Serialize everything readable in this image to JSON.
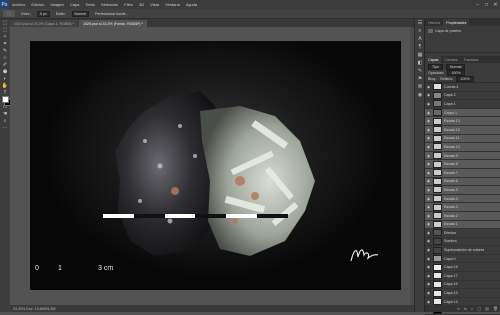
{
  "app": {
    "logo": "Ps"
  },
  "menu": [
    "Archivo",
    "Edición",
    "Imagen",
    "Capa",
    "Texto",
    "Selección",
    "Filtro",
    "3D",
    "Vista",
    "Ventana",
    "Ayuda"
  ],
  "window_controls": [
    "–",
    "□",
    "✕"
  ],
  "options_bar": {
    "feather_label": "Desv.:",
    "feather_value": "0 px",
    "style_label": "Estilo:",
    "style_value": "Normal",
    "refine_label": "Perfeccionar borde..."
  },
  "document_tabs": [
    {
      "label": "1024.psd al 33,3% (Capa 1, RGB/8) *",
      "active": false
    },
    {
      "label": "1025.psd al 33,3% (Fondo, RGB/8*) *",
      "active": true
    }
  ],
  "toolbox": [
    "⬚",
    "⬚",
    "✧",
    "⌗",
    "✎",
    "⊹",
    "✐",
    "⬣",
    "◐",
    "✋",
    "T",
    "↖",
    "▭",
    "☚",
    "⌕",
    "⋯"
  ],
  "canvas": {
    "scale_labels": [
      "0",
      "1",
      "3 cm"
    ],
    "background": "#0b0b0b",
    "scale_colors": [
      "#ffffff",
      "#111111"
    ]
  },
  "status": "33,33%   Doc: 19,5M/91,5M",
  "side_icons": [
    "☰",
    "≡",
    "A",
    "¶",
    "▦",
    "◧",
    "✎",
    "⚑",
    "⌘",
    "◉"
  ],
  "right_panel": {
    "tabs": [
      "Historia",
      "Propiedades"
    ],
    "props_title": "Capa de píxeles",
    "layers_tabs": [
      "Capas",
      "Canales",
      "Trazados"
    ],
    "filter_label": "Tipo",
    "blend": "Normal",
    "opacity_label": "Opacidad:",
    "opacity": "100%",
    "lock_label": "Bloq.:",
    "fill_label": "Relleno:",
    "fill": "100%",
    "layers": [
      {
        "name": "Curvas 4",
        "sel": false,
        "thumb": "#e0e0e0"
      },
      {
        "name": "Capa 2",
        "sel": false,
        "thumb": "#888888"
      },
      {
        "name": "Capa 1",
        "sel": false,
        "thumb": "#777777"
      },
      {
        "name": "Grupo 1",
        "sel": true,
        "thumb": "#6a6a6a"
      },
      {
        "name": "Escala 13",
        "sel": true,
        "thumb": "#cccccc"
      },
      {
        "name": "Escala 12",
        "sel": true,
        "thumb": "#cccccc"
      },
      {
        "name": "Escala 11",
        "sel": true,
        "thumb": "#cccccc"
      },
      {
        "name": "Escala 10",
        "sel": true,
        "thumb": "#cccccc"
      },
      {
        "name": "Escala 9",
        "sel": true,
        "thumb": "#cccccc"
      },
      {
        "name": "Escala 8",
        "sel": true,
        "thumb": "#cccccc"
      },
      {
        "name": "Escala 7",
        "sel": true,
        "thumb": "#cccccc"
      },
      {
        "name": "Escala 6",
        "sel": true,
        "thumb": "#cccccc"
      },
      {
        "name": "Escala 5",
        "sel": true,
        "thumb": "#cccccc"
      },
      {
        "name": "Escala 4",
        "sel": true,
        "thumb": "#cccccc"
      },
      {
        "name": "Escala 3",
        "sel": true,
        "thumb": "#cccccc"
      },
      {
        "name": "Escala 2",
        "sel": true,
        "thumb": "#cccccc"
      },
      {
        "name": "Escala 1",
        "sel": true,
        "thumb": "#cccccc"
      },
      {
        "name": "Efectos",
        "sel": false,
        "thumb": "#555555"
      },
      {
        "name": "Sombra",
        "sel": false,
        "thumb": "#444444"
      },
      {
        "name": "Superposición de colores",
        "sel": false,
        "thumb": "#444444"
      },
      {
        "name": "Capa 0",
        "sel": false,
        "thumb": "#9a9a9a"
      },
      {
        "name": "Capa 18",
        "sel": false,
        "thumb": "#f0f0f0"
      },
      {
        "name": "Capa 17",
        "sel": false,
        "thumb": "#e8e8e8"
      },
      {
        "name": "Capa 16",
        "sel": false,
        "thumb": "#e8e8e8"
      },
      {
        "name": "Capa 15",
        "sel": false,
        "thumb": "#e8e8e8"
      },
      {
        "name": "Capa 14",
        "sel": false,
        "thumb": "#e8e8e8"
      },
      {
        "name": "Fondo",
        "sel": false,
        "thumb": "#000000"
      }
    ],
    "bottom_icons": [
      "∞",
      "fx",
      "◐",
      "▢",
      "▤",
      "🗑"
    ]
  }
}
